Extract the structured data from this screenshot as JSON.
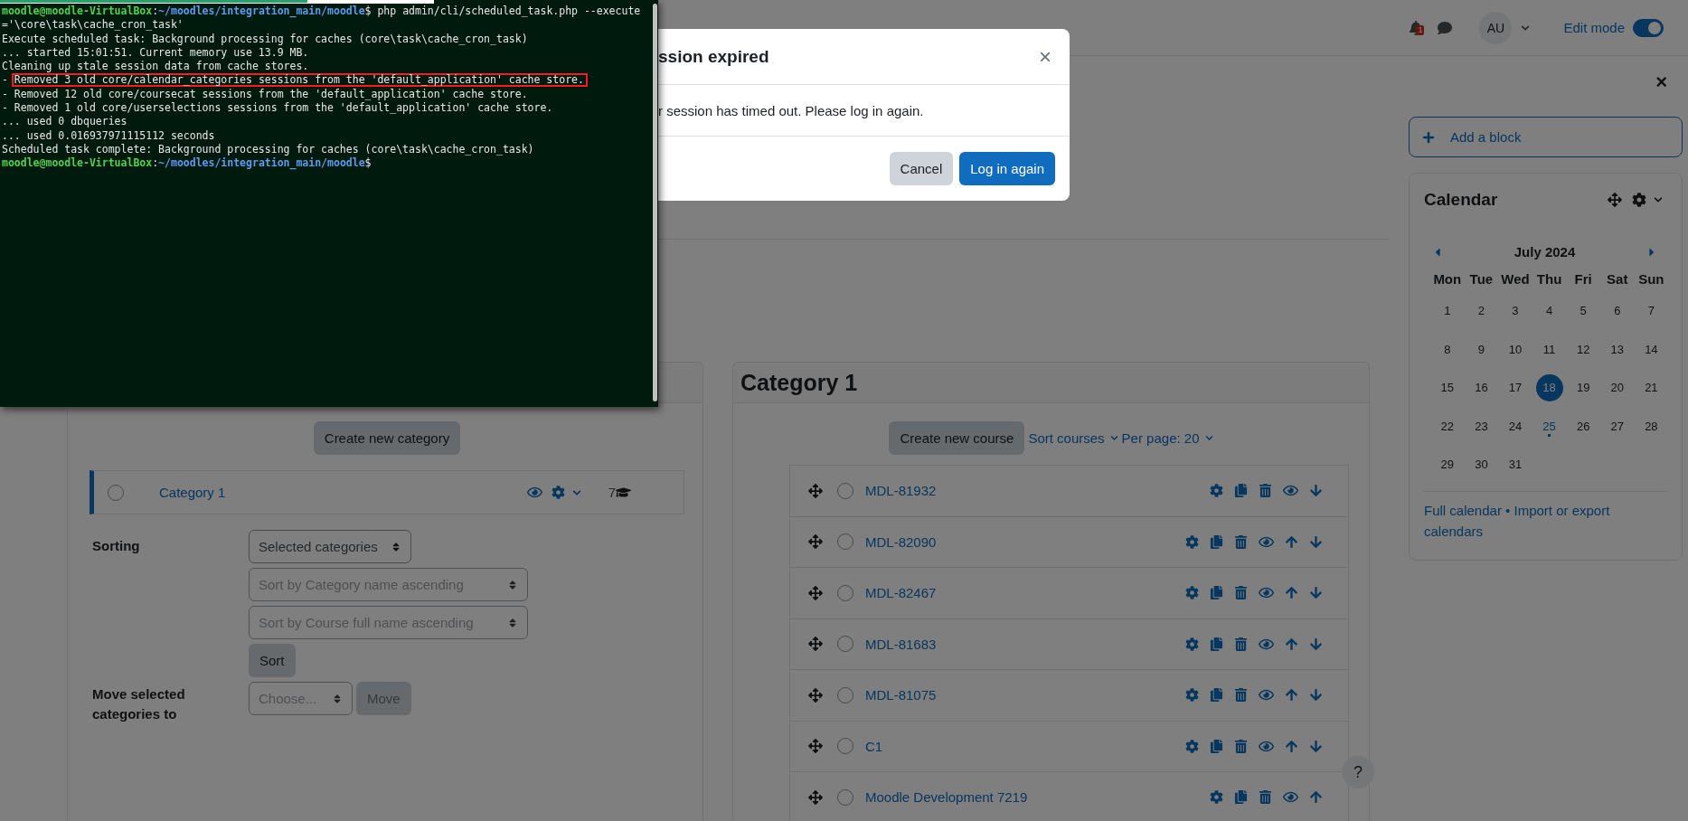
{
  "terminal": {
    "lines": [
      {
        "segments": [
          {
            "kind": "host",
            "text": "moodle@moodle-VirtualBox"
          },
          {
            "kind": "plain",
            "text": ":"
          },
          {
            "kind": "path",
            "text": "~/moodles/integration_main/moodle"
          },
          {
            "kind": "plain",
            "text": "$ php admin/cli/scheduled_task.php --execute"
          }
        ]
      },
      {
        "segments": [
          {
            "kind": "plain",
            "text": "='\\core\\task\\cache_cron_task'"
          }
        ]
      },
      {
        "segments": [
          {
            "kind": "plain",
            "text": "Execute scheduled task: Background processing for caches (core\\task\\cache_cron_task)"
          }
        ]
      },
      {
        "segments": [
          {
            "kind": "plain",
            "text": "... started 15:01:51. Current memory use 13.9 MB."
          }
        ]
      },
      {
        "segments": [
          {
            "kind": "plain",
            "text": "Cleaning up stale session data from cache stores."
          }
        ]
      },
      {
        "segments": [
          {
            "kind": "plain",
            "text": "- "
          },
          {
            "kind": "boxed",
            "text": "Removed 3 old core/calendar_categories sessions from the 'default_application' cache store."
          }
        ]
      },
      {
        "segments": [
          {
            "kind": "plain",
            "text": "- Removed 12 old core/coursecat sessions from the 'default_application' cache store."
          }
        ]
      },
      {
        "segments": [
          {
            "kind": "plain",
            "text": "- Removed 1 old core/userselections sessions from the 'default_application' cache store."
          }
        ]
      },
      {
        "segments": [
          {
            "kind": "plain",
            "text": "... used 0 dbqueries"
          }
        ]
      },
      {
        "segments": [
          {
            "kind": "plain",
            "text": "... used 0.016937971115112 seconds"
          }
        ]
      },
      {
        "segments": [
          {
            "kind": "plain",
            "text": "Scheduled task complete: Background processing for caches (core\\task\\cache_cron_task)"
          }
        ]
      },
      {
        "segments": [
          {
            "kind": "host",
            "text": "moodle@moodle-VirtualBox"
          },
          {
            "kind": "plain",
            "text": ":"
          },
          {
            "kind": "path",
            "text": "~/moodles/integration_main/moodle"
          },
          {
            "kind": "plain",
            "text": "$"
          }
        ]
      }
    ]
  },
  "modal": {
    "title": "ssion expired",
    "close": "×",
    "message": "r session has timed out. Please log in again.",
    "buttons": [
      {
        "label": "Cancel",
        "kind": "secondary"
      },
      {
        "label": "Log in again",
        "kind": "primary"
      }
    ]
  },
  "navbar": {
    "notification_count": "1",
    "avatar": "AU",
    "edit_mode": {
      "label": "Edit mode",
      "on": true
    }
  },
  "categories_panel": {
    "create_button": "Create new category",
    "categories": [
      {
        "name": "Category 1",
        "checked": false,
        "course_count": "7"
      }
    ],
    "sorting": {
      "label": "Sorting",
      "selects": [
        {
          "label": "Selected categories",
          "disabled": false
        },
        {
          "label": "Sort by Category name ascending",
          "disabled": true
        },
        {
          "label": "Sort by Course full name ascending",
          "disabled": true
        }
      ],
      "button": "Sort"
    },
    "move": {
      "label": "Move selected categories to",
      "select": {
        "label": "Choose...",
        "disabled": true
      },
      "button": {
        "label": "Move",
        "disabled": true
      }
    }
  },
  "courses_panel": {
    "title": "Category 1",
    "create_button": "Create new course",
    "sort_link": "Sort courses",
    "per_page_link": "Per page: 20",
    "courses": [
      {
        "name": "MDL-81932",
        "checked": false,
        "can_move_up": false,
        "can_move_down": true
      },
      {
        "name": "MDL-82090",
        "checked": false,
        "can_move_up": true,
        "can_move_down": true
      },
      {
        "name": "MDL-82467",
        "checked": false,
        "can_move_up": true,
        "can_move_down": true
      },
      {
        "name": "MDL-81683",
        "checked": false,
        "can_move_up": true,
        "can_move_down": true
      },
      {
        "name": "MDL-81075",
        "checked": false,
        "can_move_up": true,
        "can_move_down": true
      },
      {
        "name": "C1",
        "checked": false,
        "can_move_up": true,
        "can_move_down": true
      },
      {
        "name": "Moodle Development 7219",
        "checked": false,
        "can_move_up": true,
        "can_move_down": false
      }
    ]
  },
  "help_button": "?",
  "drawer": {
    "close": "×",
    "add_block": "Add a block",
    "calendar": {
      "title": "Calendar",
      "month": "July 2024",
      "weekdays": [
        "Mon",
        "Tue",
        "Wed",
        "Thu",
        "Fri",
        "Sat",
        "Sun"
      ],
      "days": [
        {
          "label": "1",
          "today": false,
          "event": false
        },
        {
          "label": "2",
          "today": false,
          "event": false
        },
        {
          "label": "3",
          "today": false,
          "event": false
        },
        {
          "label": "4",
          "today": false,
          "event": false
        },
        {
          "label": "5",
          "today": false,
          "event": false
        },
        {
          "label": "6",
          "today": false,
          "event": false
        },
        {
          "label": "7",
          "today": false,
          "event": false
        },
        {
          "label": "8",
          "today": false,
          "event": false
        },
        {
          "label": "9",
          "today": false,
          "event": false
        },
        {
          "label": "10",
          "today": false,
          "event": false
        },
        {
          "label": "11",
          "today": false,
          "event": false
        },
        {
          "label": "12",
          "today": false,
          "event": false
        },
        {
          "label": "13",
          "today": false,
          "event": false
        },
        {
          "label": "14",
          "today": false,
          "event": false
        },
        {
          "label": "15",
          "today": false,
          "event": false
        },
        {
          "label": "16",
          "today": false,
          "event": false
        },
        {
          "label": "17",
          "today": false,
          "event": false
        },
        {
          "label": "18",
          "today": true,
          "event": false
        },
        {
          "label": "19",
          "today": false,
          "event": false
        },
        {
          "label": "20",
          "today": false,
          "event": false
        },
        {
          "label": "21",
          "today": false,
          "event": false
        },
        {
          "label": "22",
          "today": false,
          "event": false
        },
        {
          "label": "23",
          "today": false,
          "event": false
        },
        {
          "label": "24",
          "today": false,
          "event": false
        },
        {
          "label": "25",
          "today": false,
          "event": true
        },
        {
          "label": "26",
          "today": false,
          "event": false
        },
        {
          "label": "27",
          "today": false,
          "event": false
        },
        {
          "label": "28",
          "today": false,
          "event": false
        },
        {
          "label": "29",
          "today": false,
          "event": false
        },
        {
          "label": "30",
          "today": false,
          "event": false
        },
        {
          "label": "31",
          "today": false,
          "event": false
        }
      ],
      "links": [
        "Full calendar",
        "Import or export calendars"
      ],
      "separator": "•"
    }
  }
}
